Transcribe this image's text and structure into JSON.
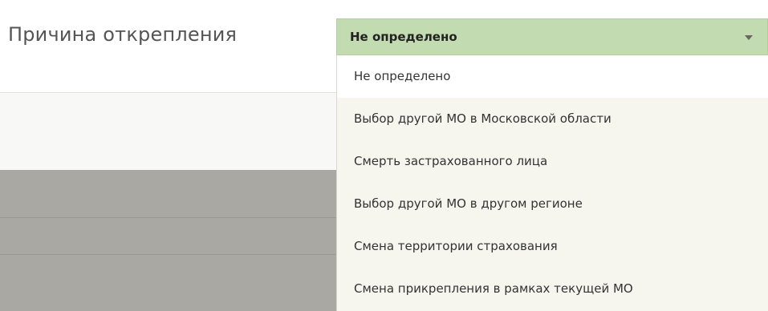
{
  "field": {
    "label": "Причина открепления"
  },
  "select": {
    "value": "Не определено",
    "caret_icon": "caret-down-icon"
  },
  "dropdown": {
    "options": [
      "Не определено",
      "Выбор другой МО в Московской области",
      "Смерть застрахованного лица",
      "Выбор другой МО в другом регионе",
      "Смена территории страхования",
      "Смена прикрепления в рамках текущей МО"
    ]
  },
  "colors": {
    "select_background": "#c2dbb0",
    "dropdown_background": "#f6f6ef",
    "overlay_gray": "#aaa8a2"
  }
}
